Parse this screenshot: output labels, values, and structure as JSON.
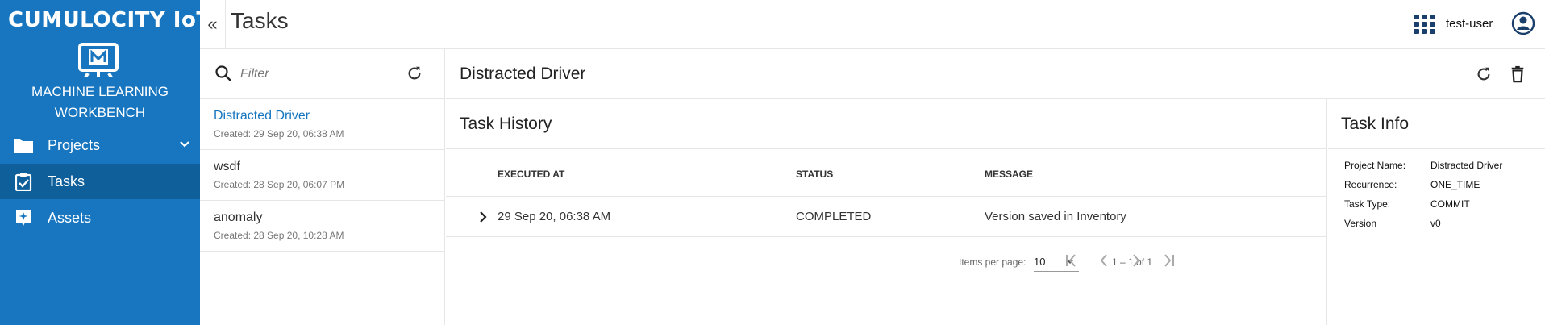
{
  "brand": {
    "name": "CUMULOCITY IoT",
    "app_name_line1": "MACHINE LEARNING",
    "app_name_line2": "WORKBENCH",
    "color": "#1776bf",
    "active_color": "#0f5f9b"
  },
  "sidebar": {
    "items": [
      {
        "label": "Projects",
        "icon": "folder-icon",
        "has_submenu": true,
        "active": false
      },
      {
        "label": "Tasks",
        "icon": "clipboard-check-icon",
        "active": true
      },
      {
        "label": "Assets",
        "icon": "assets-icon",
        "active": false
      }
    ]
  },
  "header": {
    "collapse_glyph": "«",
    "title": "Tasks",
    "username": "test-user"
  },
  "task_list": {
    "filter_placeholder": "Filter",
    "items": [
      {
        "name": "Distracted Driver",
        "created": "Created: 29 Sep 20, 06:38 AM",
        "selected": true
      },
      {
        "name": "wsdf",
        "created": "Created: 28 Sep 20, 06:07 PM",
        "selected": false
      },
      {
        "name": "anomaly",
        "created": "Created: 28 Sep 20, 10:28 AM",
        "selected": false
      }
    ]
  },
  "detail": {
    "title": "Distracted Driver",
    "history": {
      "title": "Task History",
      "columns": [
        "EXECUTED AT",
        "STATUS",
        "MESSAGE"
      ],
      "rows": [
        {
          "executed_at": "29 Sep 20, 06:38 AM",
          "status": "COMPLETED",
          "message": "Version saved in Inventory"
        }
      ],
      "paginator": {
        "items_per_page_label": "Items per page:",
        "items_per_page": "10",
        "range": "1 – 1 of 1"
      }
    },
    "info": {
      "title": "Task Info",
      "fields": [
        {
          "key": "Project Name:",
          "value": "Distracted Driver"
        },
        {
          "key": "Recurrence:",
          "value": "ONE_TIME"
        },
        {
          "key": "Task Type:",
          "value": "COMMIT"
        },
        {
          "key": "Version",
          "value": "v0"
        }
      ]
    }
  }
}
